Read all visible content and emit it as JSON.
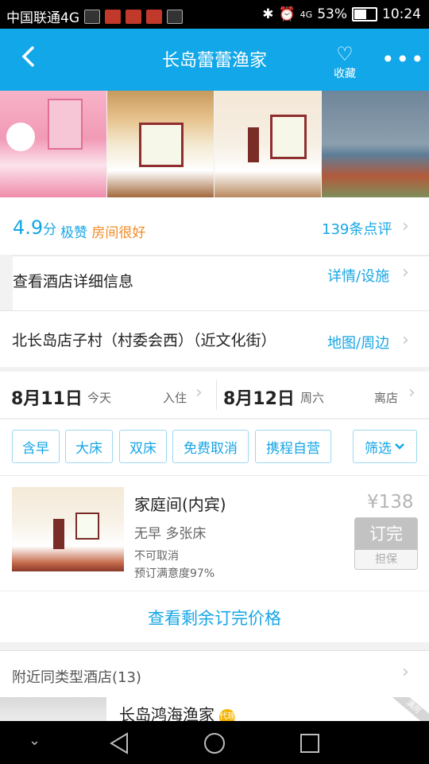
{
  "status_bar": {
    "carrier": "中国联通4G",
    "battery_pct": "53%",
    "time": "10:24",
    "network": "4G"
  },
  "header": {
    "title": "长岛蕾蕾渔家",
    "favorite_label": "收藏",
    "back_icon": "back-arrow-icon",
    "more_icon": "more-dots-icon"
  },
  "rating": {
    "score": "4.9",
    "score_unit": "分",
    "summary": "极赞",
    "highlight": "房间很好",
    "reviews_link": "139条点评"
  },
  "details": {
    "label": "查看酒店详细信息",
    "link": "详情/设施"
  },
  "address": {
    "text": "北长岛店子村（村委会西）（近文化街）",
    "link": "地图/周边"
  },
  "dates": {
    "checkin_date": "8月11日",
    "checkin_day": "今天",
    "checkin_label": "入住",
    "checkout_date": "8月12日",
    "checkout_day": "周六",
    "checkout_label": "离店"
  },
  "filters": {
    "tags": [
      "含早",
      "大床",
      "双床",
      "免费取消",
      "携程自营"
    ],
    "filter_label": "筛选"
  },
  "room": {
    "name": "家庭间(内宾)",
    "features": "无早 多张床",
    "cancel_policy": "不可取消",
    "satisfaction": "预订满意度97%",
    "price": "¥138",
    "book_label": "订完",
    "guarantee_label": "担保"
  },
  "remaining_link": "查看剩余订完价格",
  "nearby": {
    "title": "附近同类型酒店(13)",
    "first_hotel": "长岛鸿海渔家",
    "badge": "代理",
    "ribbon": "满房"
  },
  "colors": {
    "header_blue": "#12a7e8",
    "link_blue": "#16a6e6",
    "orange": "#f08a24"
  }
}
